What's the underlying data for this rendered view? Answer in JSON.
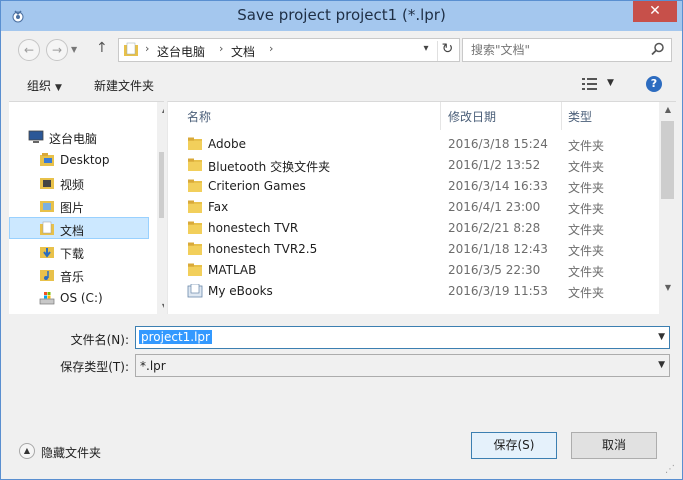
{
  "window": {
    "title": "Save project project1 (*.lpr)",
    "close_label": "✕"
  },
  "nav": {
    "back": "←",
    "forward": "→",
    "up": "↑",
    "crumbs": [
      "这台电脑",
      "文档"
    ],
    "search_placeholder": "搜索\"文档\""
  },
  "toolbar": {
    "organize": "组织",
    "new_folder": "新建文件夹",
    "help": "?"
  },
  "tree": {
    "items": [
      {
        "label": "这台电脑",
        "icon": "computer-icon"
      },
      {
        "label": "Desktop",
        "icon": "folder-icon"
      },
      {
        "label": "视频",
        "icon": "video-folder-icon"
      },
      {
        "label": "图片",
        "icon": "pictures-folder-icon"
      },
      {
        "label": "文档",
        "icon": "documents-folder-icon",
        "selected": true
      },
      {
        "label": "下载",
        "icon": "downloads-folder-icon"
      },
      {
        "label": "音乐",
        "icon": "music-folder-icon"
      },
      {
        "label": "OS (C:)",
        "icon": "drive-icon"
      }
    ]
  },
  "list": {
    "columns": {
      "name": "名称",
      "date": "修改日期",
      "type": "类型"
    },
    "rows": [
      {
        "name": "Adobe",
        "date": "2016/3/18 15:24",
        "type": "文件夹",
        "icon": "folder-icon"
      },
      {
        "name": "Bluetooth 交换文件夹",
        "date": "2016/1/2 13:52",
        "type": "文件夹",
        "icon": "folder-icon"
      },
      {
        "name": "Criterion Games",
        "date": "2016/3/14 16:33",
        "type": "文件夹",
        "icon": "folder-icon"
      },
      {
        "name": "Fax",
        "date": "2016/4/1 23:00",
        "type": "文件夹",
        "icon": "folder-icon"
      },
      {
        "name": "honestech TVR",
        "date": "2016/2/21 8:28",
        "type": "文件夹",
        "icon": "folder-icon"
      },
      {
        "name": "honestech TVR2.5",
        "date": "2016/1/18 12:43",
        "type": "文件夹",
        "icon": "folder-icon"
      },
      {
        "name": "MATLAB",
        "date": "2016/3/5 22:30",
        "type": "文件夹",
        "icon": "folder-icon"
      },
      {
        "name": "My eBooks",
        "date": "2016/3/19 11:53",
        "type": "文件夹",
        "icon": "ebooks-folder-icon"
      }
    ]
  },
  "form": {
    "filename_label": "文件名(N):",
    "filename_value": "project1.lpr",
    "filetype_label": "保存类型(T):",
    "filetype_value": "*.lpr"
  },
  "footer": {
    "hide_folders": "隐藏文件夹",
    "save": "保存(S)",
    "cancel": "取消"
  },
  "colors": {
    "titlebar": "#a4c7ee",
    "close": "#c7504a",
    "selection": "#cce8ff",
    "folder": "#e8c14a"
  }
}
